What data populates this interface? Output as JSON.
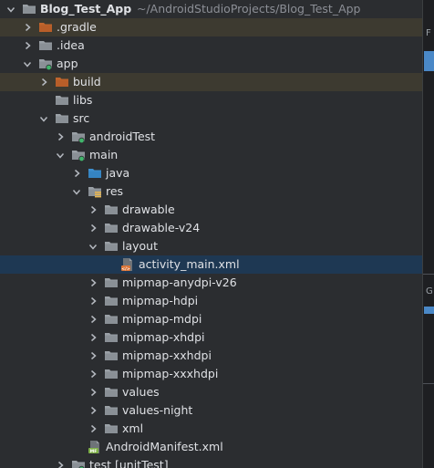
{
  "project": {
    "name": "Blog_Test_App",
    "path": "~/AndroidStudioProjects/Blog_Test_App"
  },
  "tree": [
    {
      "label": "Blog_Test_App",
      "depth": 0,
      "chevron": "down",
      "icon": "folder-gray",
      "extra": "~/AndroidStudioProjects/Blog_Test_App",
      "bold": true
    },
    {
      "label": ".gradle",
      "depth": 1,
      "chevron": "right",
      "icon": "folder-orange",
      "highlight": "brown"
    },
    {
      "label": ".idea",
      "depth": 1,
      "chevron": "right",
      "icon": "folder-gray"
    },
    {
      "label": "app",
      "depth": 1,
      "chevron": "down",
      "icon": "folder-module"
    },
    {
      "label": "build",
      "depth": 2,
      "chevron": "right",
      "icon": "folder-orange",
      "highlight": "brown"
    },
    {
      "label": "libs",
      "depth": 2,
      "chevron": "none",
      "icon": "folder-gray"
    },
    {
      "label": "src",
      "depth": 2,
      "chevron": "down",
      "icon": "folder-gray"
    },
    {
      "label": "androidTest",
      "depth": 3,
      "chevron": "right",
      "icon": "folder-module"
    },
    {
      "label": "main",
      "depth": 3,
      "chevron": "down",
      "icon": "folder-module"
    },
    {
      "label": "java",
      "depth": 4,
      "chevron": "right",
      "icon": "folder-blue"
    },
    {
      "label": "res",
      "depth": 4,
      "chevron": "down",
      "icon": "folder-res"
    },
    {
      "label": "drawable",
      "depth": 5,
      "chevron": "right",
      "icon": "folder-gray"
    },
    {
      "label": "drawable-v24",
      "depth": 5,
      "chevron": "right",
      "icon": "folder-gray"
    },
    {
      "label": "layout",
      "depth": 5,
      "chevron": "down",
      "icon": "folder-gray"
    },
    {
      "label": "activity_main.xml",
      "depth": 6,
      "chevron": "none",
      "icon": "file-xml",
      "highlight": "blue"
    },
    {
      "label": "mipmap-anydpi-v26",
      "depth": 5,
      "chevron": "right",
      "icon": "folder-gray"
    },
    {
      "label": "mipmap-hdpi",
      "depth": 5,
      "chevron": "right",
      "icon": "folder-gray"
    },
    {
      "label": "mipmap-mdpi",
      "depth": 5,
      "chevron": "right",
      "icon": "folder-gray"
    },
    {
      "label": "mipmap-xhdpi",
      "depth": 5,
      "chevron": "right",
      "icon": "folder-gray"
    },
    {
      "label": "mipmap-xxhdpi",
      "depth": 5,
      "chevron": "right",
      "icon": "folder-gray"
    },
    {
      "label": "mipmap-xxxhdpi",
      "depth": 5,
      "chevron": "right",
      "icon": "folder-gray"
    },
    {
      "label": "values",
      "depth": 5,
      "chevron": "right",
      "icon": "folder-gray"
    },
    {
      "label": "values-night",
      "depth": 5,
      "chevron": "right",
      "icon": "folder-gray"
    },
    {
      "label": "xml",
      "depth": 5,
      "chevron": "right",
      "icon": "folder-gray"
    },
    {
      "label": "AndroidManifest.xml",
      "depth": 4,
      "chevron": "none",
      "icon": "file-manifest"
    },
    {
      "label": "test [unitTest]",
      "depth": 3,
      "chevron": "right",
      "icon": "folder-module"
    }
  ],
  "right_panel": {
    "letters": [
      "F",
      "G"
    ]
  },
  "colors": {
    "background": "#2b2d30",
    "text": "#dfe1e5",
    "path_text": "#8c8f96",
    "highlight_brown": "#3d3a30",
    "highlight_blue": "#1e3853",
    "folder_gray": "#9aa0a6",
    "folder_orange": "#c0652d",
    "folder_blue": "#3d8fcf",
    "module_dot": "#40b56b"
  }
}
